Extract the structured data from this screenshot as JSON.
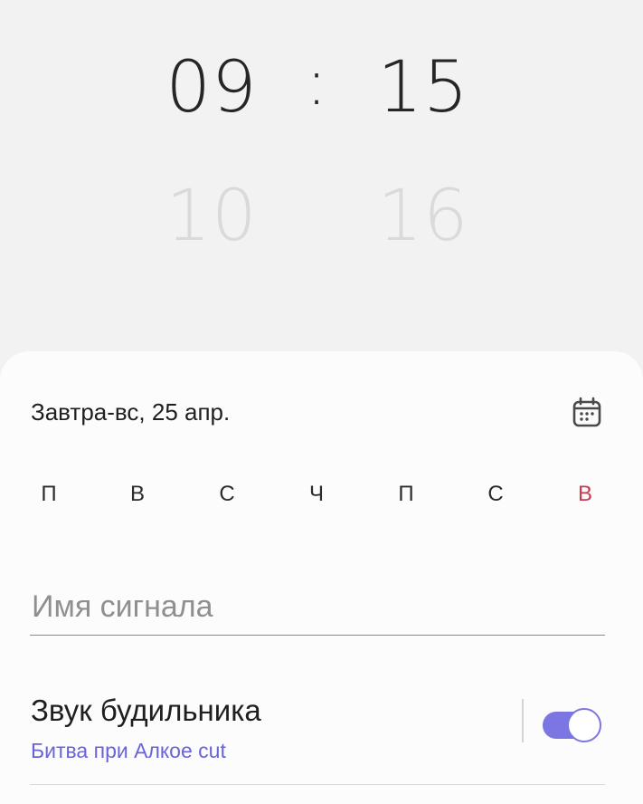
{
  "time_picker": {
    "hour": "09",
    "minute": "15",
    "separator": ":",
    "next_hour": "10",
    "next_minute": "16"
  },
  "date": {
    "text": "Завтра-вс, 25 апр.",
    "calendar_icon": "calendar-icon"
  },
  "weekdays": [
    "П",
    "В",
    "С",
    "Ч",
    "П",
    "С",
    "В"
  ],
  "weekday_sunday_color": "#d0384d",
  "alarm_name": {
    "placeholder": "Имя сигнала",
    "value": ""
  },
  "sound": {
    "title": "Звук будильника",
    "subtitle": "Битва при Алкое cut",
    "enabled": true
  },
  "colors": {
    "accent": "#7c76e2",
    "subtitle": "#6a63d8",
    "background": "#f2f2f2",
    "sheet": "#fcfcfc"
  }
}
